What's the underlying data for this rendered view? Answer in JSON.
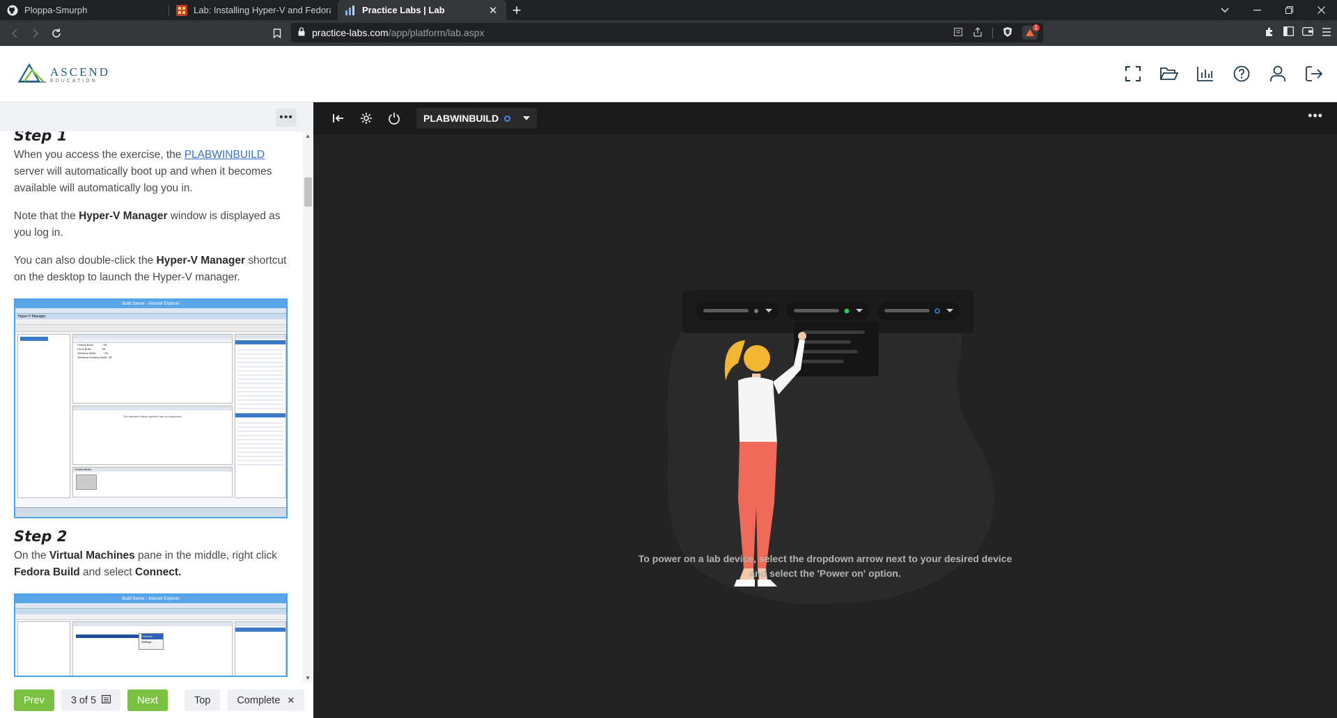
{
  "browser": {
    "tabs": [
      {
        "title": "Ploppa-Smurph",
        "icon": "github-icon",
        "active": false
      },
      {
        "title": "Lab: Installing Hyper-V and Fedora Linux",
        "icon": "lab-icon",
        "active": false
      },
      {
        "title": "Practice Labs | Lab",
        "icon": "practice-labs-icon",
        "active": true
      }
    ],
    "url_host": "practice-labs.com",
    "url_path": "/app/platform/lab.aspx",
    "shield_count": "1"
  },
  "app": {
    "logo_text": "ASCEND",
    "logo_sub": "EDUCATION",
    "header_icons": [
      "fullscreen-icon",
      "folder-icon",
      "stats-icon",
      "help-icon",
      "user-icon",
      "logout-icon"
    ]
  },
  "lab": {
    "step1_title": "Step 1",
    "step1_p1_before": "When you access the exercise, the ",
    "step1_p1_link": "PLABWINBUILD",
    "step1_p1_after": " server will automatically boot up and when it becomes available will automatically log you in.",
    "step1_p2_before": "Note that the ",
    "step1_p2_bold": "Hyper-V Manager",
    "step1_p2_after": " window is displayed as you log in.",
    "step1_p3_before": "You can also double-click the ",
    "step1_p3_bold": "Hyper-V Manager",
    "step1_p3_after": " shortcut on the desktop to launch the Hyper-V manager.",
    "step2_title": "Step 2",
    "step2_p1_a": "On the ",
    "step2_p1_b": "Virtual Machines",
    "step2_p1_c": " pane in the middle, right click ",
    "step2_p1_d": "Fedora Build",
    "step2_p1_e": " and select ",
    "step2_p1_f": "Connect.",
    "screenshot1_title": "Build Server - Internet Explorer",
    "screenshot1_app": "Hyper-V Manager",
    "screenshot1_vms": [
      "Fedora Build",
      "Linux Build",
      "Windows Build",
      "Windows Desktop Build"
    ],
    "screenshot1_vm_state": "Off",
    "screenshot1_snapshots_msg": "The selected virtual machine has no snapshots.",
    "screenshot1_selected_vm": "Fedora Build",
    "screenshot2_title": "Build Server - Internet Explorer",
    "screenshot2_menu": [
      "Connect...",
      "Settings..."
    ]
  },
  "nav": {
    "prev": "Prev",
    "progress": "3 of 5",
    "next": "Next",
    "top": "Top",
    "complete": "Complete"
  },
  "device": {
    "name": "PLABWINBUILD",
    "status_color": "#3b8be6"
  },
  "hint": {
    "line1": "To power on a lab device, select the dropdown arrow next to your desired device",
    "line2": "and select the 'Power on' option."
  },
  "colors": {
    "accent_green": "#7ac142",
    "link_blue": "#3a6fc4",
    "dark_bg": "#232323"
  }
}
